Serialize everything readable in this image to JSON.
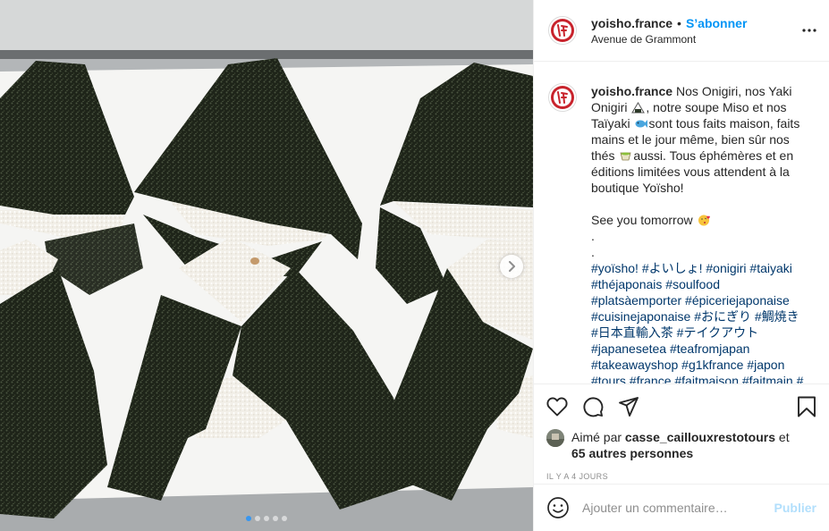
{
  "post": {
    "username": "yoisho.france",
    "follow_label": "S’abonner",
    "separator": "•",
    "location": "Avenue de Grammont",
    "more_icon": "more-horizontal-icon"
  },
  "caption": {
    "username": "yoisho.france",
    "lines": [
      "Nos Onigiri, nos Yaki",
      "Onigiri",
      ", notre soupe Miso et nos",
      "Taïyaki",
      "sont tous faits maison, faits",
      "mains et le jour même, bien sûr nos",
      "thés",
      "aussi. Tous éphémères et en",
      "éditions limitées vous attendent à la",
      "boutique Yoïsho!",
      "See you tomorrow",
      ".",
      "."
    ],
    "hashtags": [
      "#yoïsho! #よいしょ! #onigiri #taiyaki",
      "#théjaponais #soulfood",
      "#platsàemporter #épiceriejaponaise",
      "#cuisinejaponaise #おにぎり #鯛焼き",
      "#日本直輸入茶 #テイクアウト",
      "#japanesetea #teafromjapan",
      "#takeawayshop #g1kfrance #japon",
      "#tours #france #faitmaison #faitmain #"
    ],
    "emojis": [
      "rice-ball-emoji",
      "fish-emoji",
      "tea-emoji",
      "kiss-face-emoji"
    ]
  },
  "actions": {
    "icons": [
      "heart-icon",
      "comment-icon",
      "share-icon",
      "bookmark-icon"
    ]
  },
  "likes": {
    "prefix": "Aimé par",
    "user": "casse_caillouxrestotours",
    "and": "et",
    "others": "65 autres personnes"
  },
  "timestamp": "IL Y A 4 JOURS",
  "comment": {
    "placeholder": "Ajouter un commentaire…",
    "publish_label": "Publier"
  },
  "carousel": {
    "slide_count": 5,
    "active_index": 0
  },
  "colors": {
    "accent": "#0095f6",
    "hashtag": "#00376b",
    "publish_disabled": "#b2dffc",
    "muted": "#8e8e8e",
    "avatar_red": "#c8232c"
  }
}
